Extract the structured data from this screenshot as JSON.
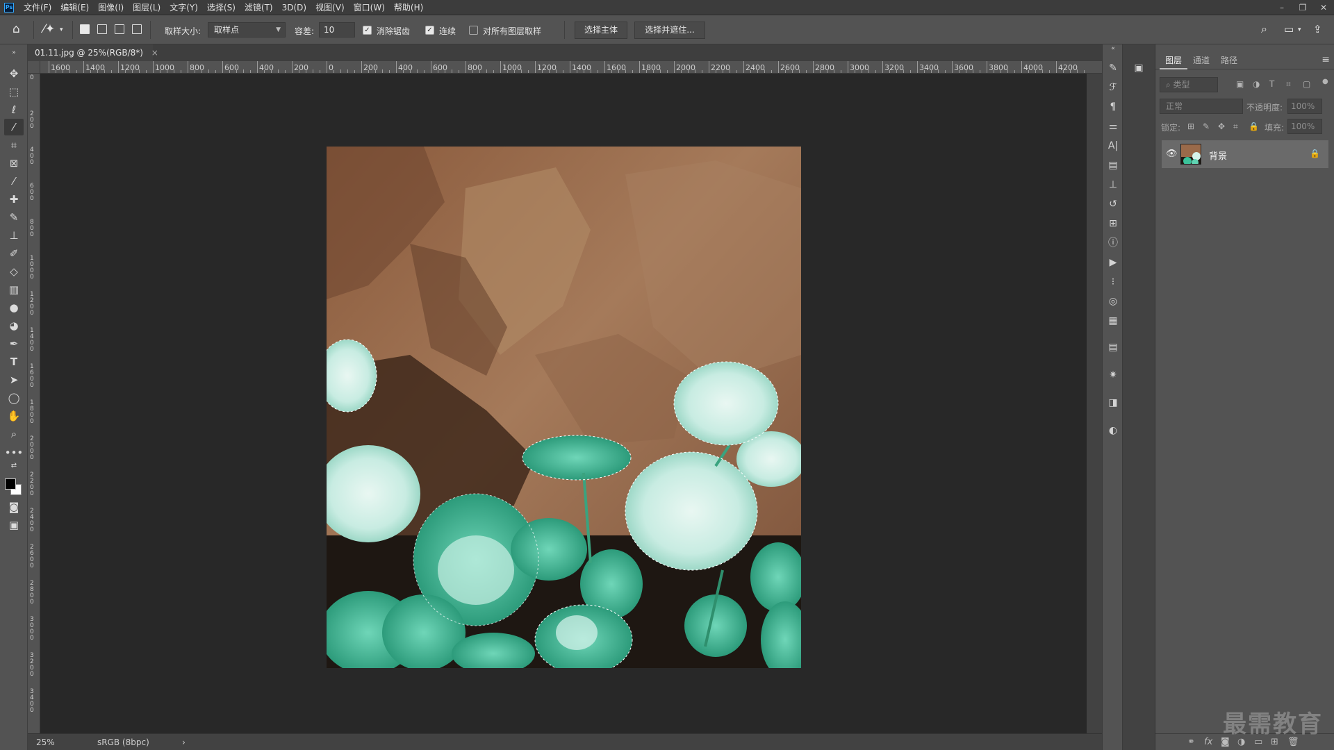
{
  "menubar": {
    "app_logo": "Ps",
    "items": [
      "文件(F)",
      "编辑(E)",
      "图像(I)",
      "图层(L)",
      "文字(Y)",
      "选择(S)",
      "滤镜(T)",
      "3D(D)",
      "视图(V)",
      "窗口(W)",
      "帮助(H)"
    ],
    "window_controls": [
      "–",
      "❐",
      "✕"
    ]
  },
  "options": {
    "sample_size_label": "取样大小:",
    "sample_size_value": "取样点",
    "tolerance_label": "容差:",
    "tolerance_value": "10",
    "anti_alias_label": "消除锯齿",
    "anti_alias_checked": true,
    "contiguous_label": "连续",
    "contiguous_checked": true,
    "sample_all_layers_label": "对所有图层取样",
    "sample_all_layers_checked": false,
    "select_subject_label": "选择主体",
    "select_and_mask_label": "选择并遮住..."
  },
  "document": {
    "tab_title": "01.11.jpg @ 25%(RGB/8*)",
    "tab_close": "×",
    "ruler_h_labels": [
      "1600",
      "1400",
      "1200",
      "1000",
      "800",
      "600",
      "400",
      "200",
      "0",
      "200",
      "400",
      "600",
      "800",
      "1000",
      "1200",
      "1400",
      "1600",
      "1800",
      "2000",
      "2200",
      "2400",
      "2600",
      "2800",
      "3000",
      "3200",
      "3400",
      "3600",
      "3800",
      "4000",
      "4200"
    ],
    "ruler_v_labels": [
      "0",
      "2 0 0",
      "4 0 0",
      "6 0 0",
      "8 0 0",
      "1 0 0 0",
      "1 2 0 0",
      "1 4 0 0",
      "1 6 0 0",
      "1 8 0 0",
      "2 0 0 0",
      "2 2 0 0",
      "2 4 0 0",
      "2 6 0 0",
      "2 8 0 0",
      "3 0 0 0",
      "3 2 0 0",
      "3 4 0 0"
    ]
  },
  "status": {
    "zoom": "25%",
    "color_profile": "sRGB (8bpc)",
    "arrow": "›"
  },
  "layers_panel": {
    "tabs": [
      "图层",
      "通道",
      "路径"
    ],
    "active_tab": "图层",
    "filter_placeholder": "类型",
    "blend_mode": "正常",
    "opacity_label": "不透明度:",
    "opacity_value": "100%",
    "lock_label": "锁定:",
    "fill_label": "填充:",
    "fill_value": "100%",
    "layers": [
      {
        "name": "背景",
        "visible": true,
        "locked": true
      }
    ]
  },
  "watermark": "最需教育",
  "colors": {
    "accent": "#31a8ff",
    "canvas_bg": "#282828",
    "panel_bg": "#535353"
  }
}
